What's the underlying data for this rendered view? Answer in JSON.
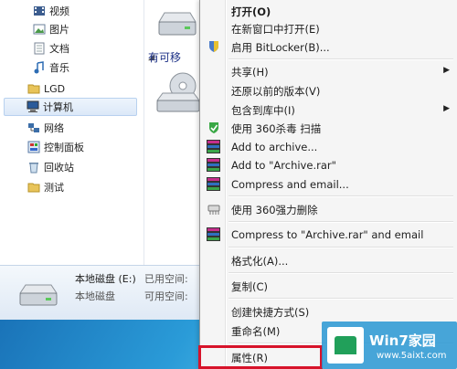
{
  "explorer": {
    "nav_items": [
      {
        "label": "视频",
        "icon": "video-library-icon"
      },
      {
        "label": "图片",
        "icon": "pictures-library-icon"
      },
      {
        "label": "文档",
        "icon": "documents-library-icon"
      },
      {
        "label": "音乐",
        "icon": "music-library-icon"
      },
      {
        "label": "LGD",
        "icon": "folder-icon"
      },
      {
        "label": "计算机",
        "icon": "computer-icon"
      },
      {
        "label": "网络",
        "icon": "network-icon"
      },
      {
        "label": "控制面板",
        "icon": "control-panel-icon"
      },
      {
        "label": "回收站",
        "icon": "recycle-bin-icon"
      },
      {
        "label": "测试",
        "icon": "folder-icon"
      }
    ],
    "group_header": "有可移",
    "details": {
      "drive_name": "本地磁盘 (E:)",
      "drive_type": "本地磁盘",
      "used_label": "已用空间:",
      "free_label": "可用空间:"
    }
  },
  "context_menu": {
    "items": {
      "open": "打开(O)",
      "open_new_window": "在新窗口中打开(E)",
      "bitlocker": "启用 BitLocker(B)...",
      "share": "共享(H)",
      "restore_versions": "还原以前的版本(V)",
      "include_library": "包含到库中(I)",
      "scan_360": "使用 360杀毒 扫描",
      "add_archive": "Add to archive...",
      "add_archive_rar": "Add to \"Archive.rar\"",
      "compress_email": "Compress and email...",
      "force_delete_360": "使用 360强力删除",
      "compress_rar_email": "Compress to \"Archive.rar\" and email",
      "format": "格式化(A)...",
      "copy": "复制(C)",
      "create_shortcut": "创建快捷方式(S)",
      "rename": "重命名(M)",
      "properties": "属性(R)"
    }
  },
  "watermark": {
    "brand": "Win7家园",
    "url": "www.5aixt.com"
  },
  "colors": {
    "highlight": "#d7132a",
    "menu_bg": "#f5f5f5"
  }
}
